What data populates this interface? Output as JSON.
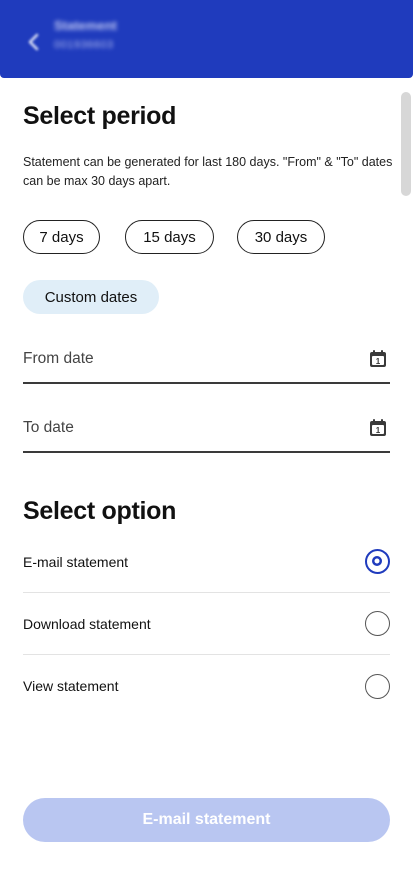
{
  "header": {
    "title": "Statement",
    "subtitle": "001936603",
    "back_icon": "chevron-left-icon",
    "bg_color": "#1f3bbd"
  },
  "period": {
    "title": "Select period",
    "description": "Statement can be generated for last 180 days. \"From\" & \"To\" dates can be max 30 days apart.",
    "chips": [
      "7 days",
      "15 days",
      "30 days"
    ],
    "custom_label": "Custom dates",
    "from_label": "From date",
    "to_label": "To date",
    "calendar_icon": "calendar-icon"
  },
  "options": {
    "title": "Select option",
    "items": [
      {
        "label": "E-mail statement",
        "selected": true
      },
      {
        "label": "Download statement",
        "selected": false
      },
      {
        "label": "View statement",
        "selected": false
      }
    ],
    "accent_color": "#1f3bbd"
  },
  "action": {
    "button_label": "E-mail statement",
    "disabled": true
  }
}
